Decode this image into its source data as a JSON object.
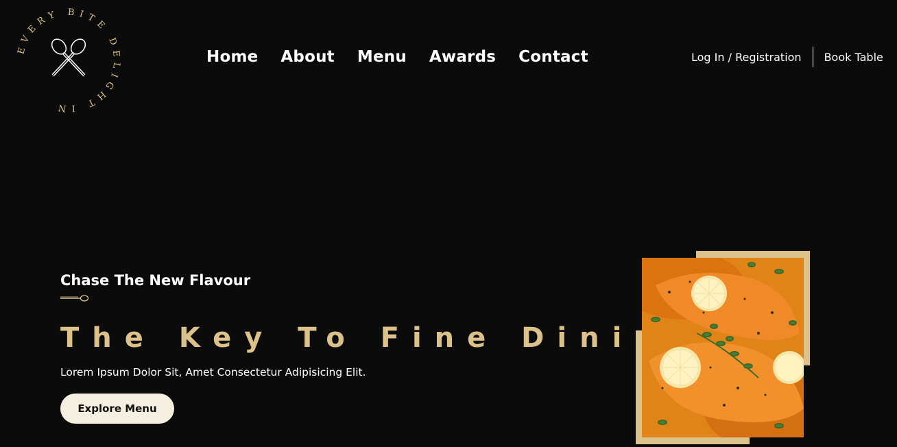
{
  "logo": {
    "circular_text": "EVERY BITE DELIGHT IN",
    "icon": "crossed-spoons-icon"
  },
  "nav": {
    "items": [
      {
        "label": "Home"
      },
      {
        "label": "About"
      },
      {
        "label": "Menu"
      },
      {
        "label": "Awards"
      },
      {
        "label": "Contact"
      }
    ]
  },
  "auth": {
    "login_label": "Log In / Registration",
    "book_label": "Book Table"
  },
  "hero": {
    "tagline": "Chase The New Flavour",
    "headline": "The Key To Fine Dining",
    "subtext": "Lorem Ipsum Dolor Sit, Amet Consectetur Adipisicing Elit.",
    "cta_label": "Explore Menu"
  },
  "colors": {
    "background": "#0b0b0c",
    "accent_gold": "#dcc28a",
    "button_bg": "#f6efdf",
    "text": "#ffffff"
  }
}
